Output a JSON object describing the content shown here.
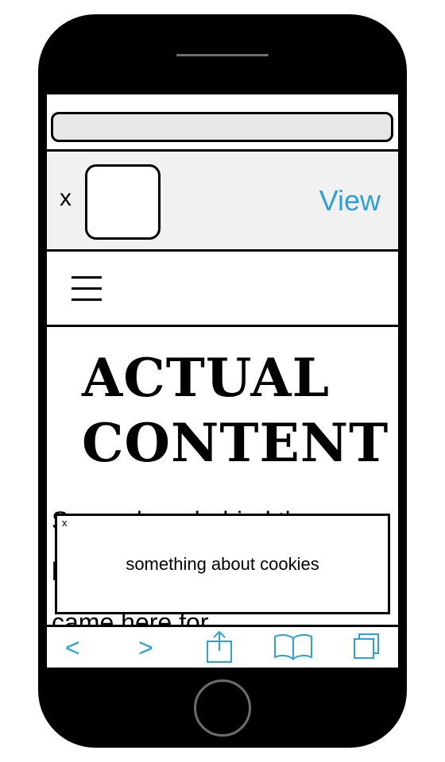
{
  "banner": {
    "close_label": "x",
    "view_label": "View"
  },
  "article": {
    "headline_line1": "ACTUAL",
    "headline_line2": "CONTENT",
    "body_line1": "Somewhere behind these",
    "body_line2": "l",
    "body_line3": "came here for"
  },
  "cookie_notice": {
    "close_label": "x",
    "message": "something about cookies"
  },
  "toolbar": {
    "back_label": "<",
    "forward_label": ">",
    "icons": [
      "share-icon",
      "bookmarks-icon",
      "tabs-icon"
    ]
  },
  "colors": {
    "accent": "#2e9fd8",
    "banner_bg": "#f1f1f1",
    "url_bar_bg": "#e7e7e7"
  }
}
